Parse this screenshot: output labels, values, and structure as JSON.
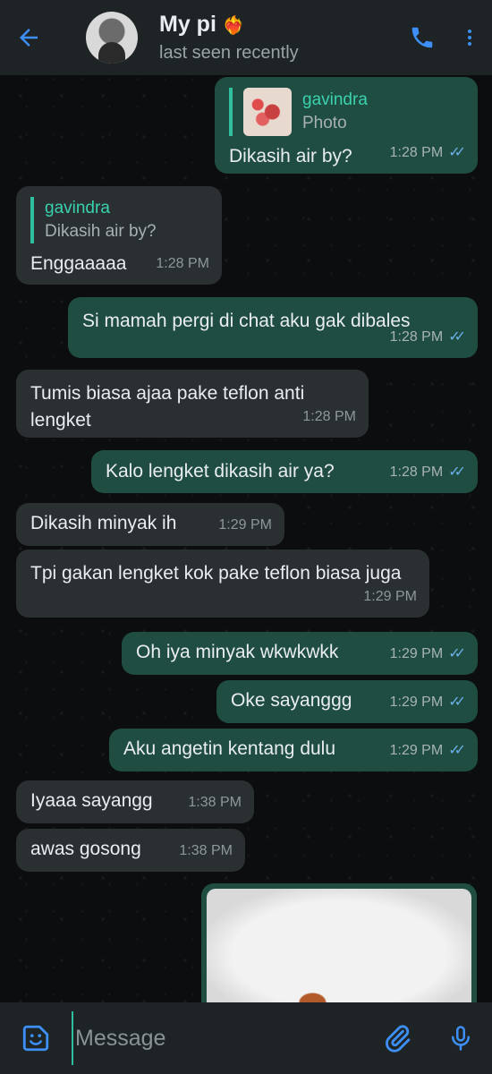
{
  "header": {
    "title": "My pi",
    "title_emoji": "❤️‍🔥",
    "subtitle": "last seen recently"
  },
  "messages": [
    {
      "dir": "out",
      "quote": {
        "name": "gavindra",
        "body": "Photo"
      },
      "text": "Dikasih air by?",
      "time": "1:28 PM"
    },
    {
      "dir": "in",
      "quote": {
        "name": "gavindra",
        "body": "Dikasih air by?"
      },
      "text": "Enggaaaaa",
      "time": "1:28 PM"
    },
    {
      "dir": "out",
      "text": "Si mamah pergi di chat aku gak dibales",
      "time": "1:28 PM"
    },
    {
      "dir": "in",
      "text": "Tumis biasa ajaa pake teflon anti lengket",
      "time": "1:28 PM"
    },
    {
      "dir": "out",
      "text": "Kalo lengket dikasih air ya?",
      "time": "1:28 PM"
    },
    {
      "dir": "in",
      "text": "Dikasih minyak ih",
      "time": "1:29 PM"
    },
    {
      "dir": "in",
      "text": "Tpi gakan lengket kok pake teflon biasa juga",
      "time": "1:29 PM"
    },
    {
      "dir": "out",
      "text": "Oh iya minyak wkwkwkk",
      "time": "1:29 PM"
    },
    {
      "dir": "out",
      "text": "Oke sayanggg",
      "time": "1:29 PM"
    },
    {
      "dir": "out",
      "text": "Aku angetin kentang dulu",
      "time": "1:29 PM"
    },
    {
      "dir": "in",
      "text": "Iyaaa sayangg",
      "time": "1:38 PM"
    },
    {
      "dir": "in",
      "text": "awas gosong",
      "time": "1:38 PM"
    }
  ],
  "input": {
    "placeholder": "Message"
  },
  "colors": {
    "accent": "#2fbf9e",
    "outgoing_bubble": "#1f4d42",
    "incoming_bubble": "#2a2f32",
    "read_tick": "#6bb1e8",
    "header_bg": "#1e2426",
    "icon_blue": "#3d8ff5"
  },
  "icons": {
    "back": "arrow-left-icon",
    "call": "phone-icon",
    "more": "more-vertical-icon",
    "emoji": "sticker-emoji-icon",
    "attach": "paperclip-icon",
    "mic": "microphone-icon"
  }
}
